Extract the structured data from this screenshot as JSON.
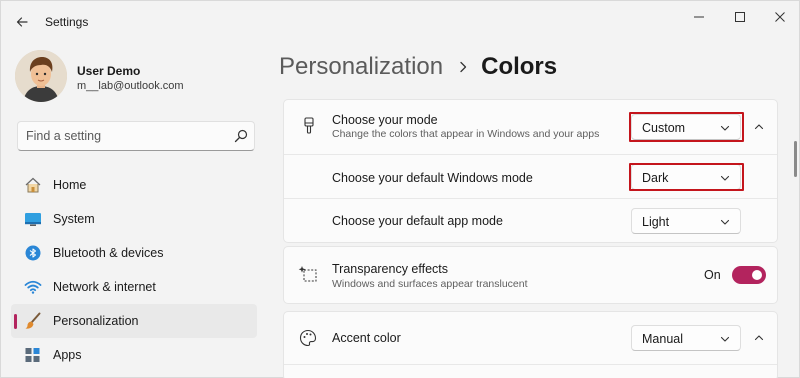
{
  "window": {
    "title": "Settings"
  },
  "user": {
    "name": "User Demo",
    "email": "m__lab@outlook.com"
  },
  "search": {
    "placeholder": "Find a setting"
  },
  "sidebar": {
    "items": [
      {
        "label": "Home",
        "icon": "home-icon"
      },
      {
        "label": "System",
        "icon": "system-icon"
      },
      {
        "label": "Bluetooth & devices",
        "icon": "bluetooth-icon"
      },
      {
        "label": "Network & internet",
        "icon": "network-icon"
      },
      {
        "label": "Personalization",
        "icon": "brush-icon",
        "active": true
      },
      {
        "label": "Apps",
        "icon": "apps-icon"
      }
    ]
  },
  "breadcrumb": {
    "parent": "Personalization",
    "current": "Colors"
  },
  "settings": {
    "mode": {
      "title": "Choose your mode",
      "description": "Change the colors that appear in Windows and your apps",
      "value": "Custom",
      "icon": "brush-icon"
    },
    "windows_mode": {
      "title": "Choose your default Windows mode",
      "value": "Dark"
    },
    "app_mode": {
      "title": "Choose your default app mode",
      "value": "Light"
    },
    "transparency": {
      "title": "Transparency effects",
      "description": "Windows and surfaces appear translucent",
      "state_label": "On",
      "icon": "transparency-icon"
    },
    "accent": {
      "title": "Accent color",
      "value": "Manual",
      "icon": "palette-icon"
    }
  },
  "colors": {
    "accent": "#b3245e",
    "highlight": "#c4151c"
  }
}
